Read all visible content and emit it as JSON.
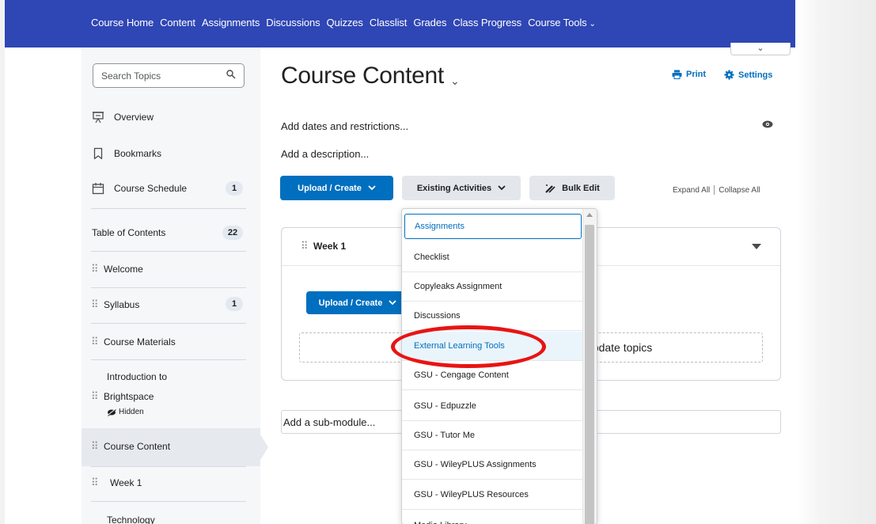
{
  "navbar": {
    "items": [
      "Course Home",
      "Content",
      "Assignments",
      "Discussions",
      "Quizzes",
      "Classlist",
      "Grades",
      "Class Progress",
      "Course Tools"
    ],
    "caret": "⌄",
    "color": "#2f46b5"
  },
  "sidebar": {
    "search_placeholder": "Search Topics",
    "links": [
      {
        "label": "Overview",
        "icon": "presentation-icon"
      },
      {
        "label": "Bookmarks",
        "icon": "bookmark-icon"
      },
      {
        "label": "Course Schedule",
        "icon": "calendar-icon",
        "count": "1"
      }
    ],
    "toc_label": "Table of Contents",
    "toc_count": "22",
    "modules": [
      {
        "label": "Welcome"
      },
      {
        "label": "Syllabus",
        "count": "1"
      },
      {
        "label": "Course Materials"
      },
      {
        "label": "Introduction to Brightspace",
        "line1": "Introduction to",
        "line2": "Brightspace",
        "status": "Hidden"
      },
      {
        "label": "Course Content",
        "active": true
      },
      {
        "label": "Week 1"
      },
      {
        "label": "Technology"
      }
    ]
  },
  "main": {
    "title": "Course Content",
    "title_caret": "⌄",
    "print_label": "Print",
    "settings_label": "Settings",
    "top_dropdown_caret": "⌄",
    "add_dates": "Add dates and restrictions...",
    "add_description": "Add a description...",
    "toolbar": {
      "upload_create": "Upload / Create",
      "existing_activities": "Existing Activities",
      "bulk_edit": "Bulk Edit",
      "expand_all": "Expand All",
      "collapse_all": "Collapse All"
    },
    "week_card": {
      "title": "Week 1",
      "upload_create": "Upload / Create",
      "drop_text": "update topics"
    },
    "add_sub_module": "Add a sub-module..."
  },
  "existing_activities_menu": {
    "items": [
      "Assignments",
      "Checklist",
      "Copyleaks Assignment",
      "Discussions",
      "External Learning Tools",
      "GSU - Cengage Content",
      "GSU - Edpuzzle",
      "GSU - Tutor Me",
      "GSU - WileyPLUS Assignments",
      "GSU - WileyPLUS Resources",
      "Media Library"
    ],
    "focused_index": 0,
    "highlighted_index": 4
  },
  "colors": {
    "primary_button": "#006fbf",
    "annotation_circle": "#e81414"
  }
}
